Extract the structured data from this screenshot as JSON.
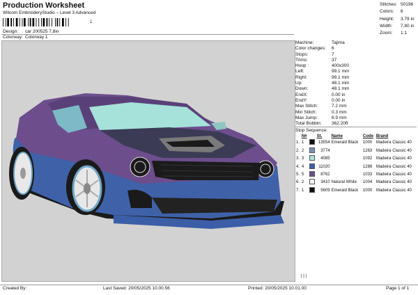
{
  "header": {
    "title": "Production Worksheet",
    "subtitle": "Wilcom EmbroideryStudio – Level 3 Advanced",
    "barcode_suffix": "1"
  },
  "design_info": {
    "design_label": "Design:",
    "design_value": "car 200525 7,8in",
    "colorway_label": "Colorway:",
    "colorway_value": "Colorway 1"
  },
  "summary": [
    {
      "label": "Stitches:",
      "value": "50196"
    },
    {
      "label": "Colors:",
      "value": "6"
    },
    {
      "label": "Height:",
      "value": "3.79 in"
    },
    {
      "label": "Width:",
      "value": "7.80 in"
    },
    {
      "label": "Zoom:",
      "value": "1:1"
    }
  ],
  "machine_info": [
    {
      "label": "Machine:",
      "value": "Tajima"
    },
    {
      "label": "Color changes:",
      "value": "6"
    },
    {
      "label": "Stops:",
      "value": "7"
    },
    {
      "label": "Trims:",
      "value": "37"
    },
    {
      "label": "Hoop :",
      "value": "400x300"
    },
    {
      "label": "Left:",
      "value": "99.1 mm"
    },
    {
      "label": "Right:",
      "value": "99.1 mm"
    },
    {
      "label": "Up:",
      "value": "48.1 mm"
    },
    {
      "label": "Down:",
      "value": "48.1 mm"
    },
    {
      "label": "EndX:",
      "value": "0.00 in"
    },
    {
      "label": "EndY:",
      "value": "0.00 in"
    },
    {
      "label": "Max Stitch:",
      "value": "7.2 mm"
    },
    {
      "label": "Min Stitch:",
      "value": "0.3 mm"
    },
    {
      "label": "Max Jump:",
      "value": "6.9 mm"
    },
    {
      "label": "Total Bobbin:",
      "value": "362.20ft"
    }
  ],
  "stop_sequence": {
    "title": "Stop Sequence:",
    "headers": {
      "n": "N#",
      "st": "St.",
      "name": "Name",
      "code": "Code",
      "brand": "Brand"
    },
    "rows": [
      {
        "stop": "1.",
        "n": "1",
        "color": "#111111",
        "st": "13554",
        "name": "Emerald Black",
        "code": "1000",
        "brand": "Madeira Classic 40"
      },
      {
        "stop": "2.",
        "n": "2",
        "color": "#7a8fb4",
        "st": "3774",
        "name": "",
        "code": "1263",
        "brand": "Madeira Classic 40"
      },
      {
        "stop": "3.",
        "n": "3",
        "color": "#a7e3dc",
        "st": "4085",
        "name": "",
        "code": "1092",
        "brand": "Madeira Classic 40"
      },
      {
        "stop": "4.",
        "n": "4",
        "color": "#3a5fa4",
        "st": "11020",
        "name": "",
        "code": "1286",
        "brand": "Madeira Classic 40"
      },
      {
        "stop": "5.",
        "n": "5",
        "color": "#6d4f8e",
        "st": "8762",
        "name": "",
        "code": "1033",
        "brand": "Madeira Classic 40"
      },
      {
        "stop": "6.",
        "n": "2",
        "color": "#f4f4f4",
        "st": "3410",
        "name": "Natural White",
        "code": "1004",
        "brand": "Madeira Classic 40"
      },
      {
        "stop": "7.",
        "n": "1",
        "color": "#111111",
        "st": "5609",
        "name": "Emerald Black",
        "code": "1000",
        "brand": "Madeira Classic 40"
      }
    ]
  },
  "footer": {
    "created_by": "Created By:",
    "last_saved": "Last Saved: 20/05/2025 10.00.56",
    "printed": "Printed: 20/05/2025 10.01.00",
    "page": "Page 1 of 1"
  },
  "colors": {
    "body_purple": "#6a4a8a",
    "body_blue": "#3b5ea6",
    "glass": "#a6e2da",
    "background": "#d2d2d2"
  }
}
